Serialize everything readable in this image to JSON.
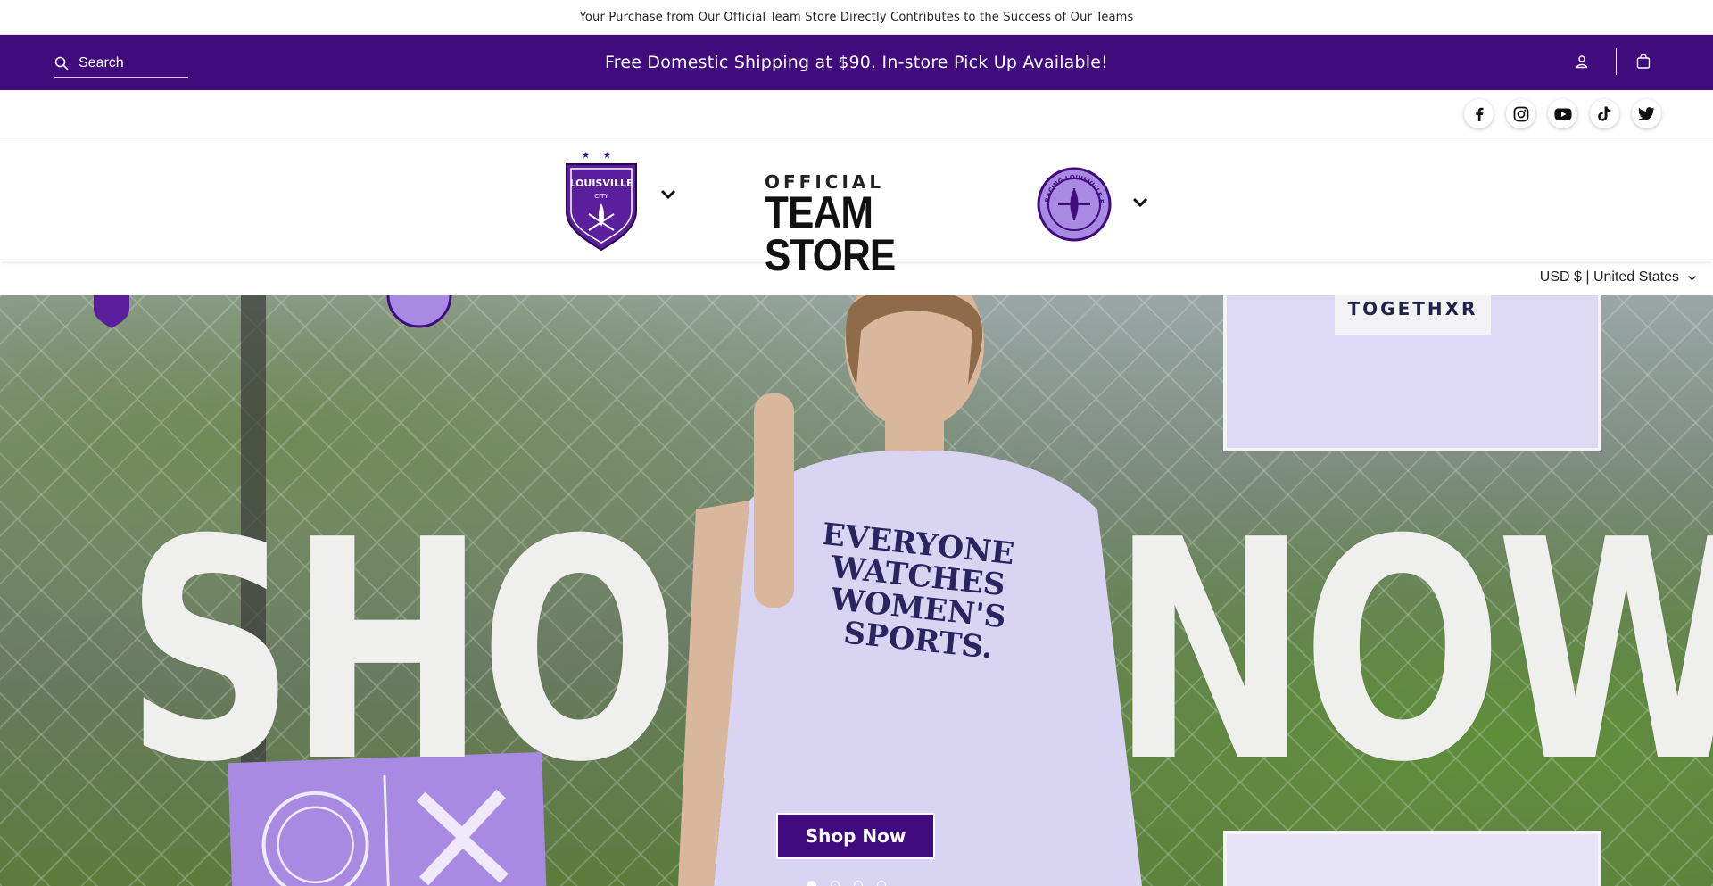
{
  "announcement": "Your Purchase from Our Official Team Store Directly Contributes to the Success of Our Teams",
  "header": {
    "search_placeholder": "Search",
    "promo": "Free Domestic Shipping at $90. In-store Pick Up Available!",
    "brand_color": "#3f0b7d"
  },
  "social": [
    "facebook-icon",
    "instagram-icon",
    "youtube-icon",
    "tiktok-icon",
    "twitter-icon"
  ],
  "logos": {
    "store_small": "OFFICIAL",
    "store_big": "TEAM STORE",
    "lcfc_text": "LOUISVILLE",
    "lcfc_sub": "CITY",
    "rlfc_text": "RACING LOUISVILLE FOOTBALL CLUB"
  },
  "currency": "USD $ | United States",
  "hero": {
    "word_left": "SHOP",
    "word_right": "NOW",
    "shirt_text": "EVERYONE WATCHES WOMEN'S SPORTS.",
    "label_text": "TOGETHXR",
    "cta": "Shop Now",
    "slides": 4,
    "active_slide": 1
  }
}
